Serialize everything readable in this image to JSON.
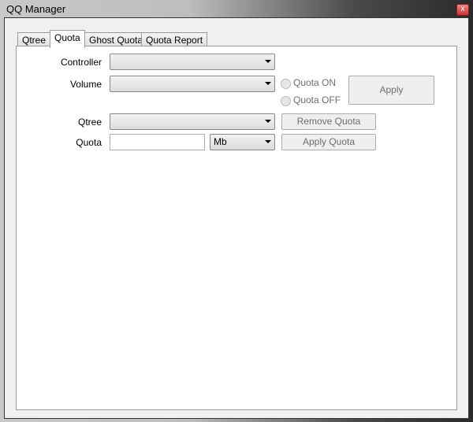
{
  "window": {
    "title": "QQ Manager",
    "close_label": "x"
  },
  "tabs": [
    {
      "label": "Qtree"
    },
    {
      "label": "Quota"
    },
    {
      "label": "Ghost Quota"
    },
    {
      "label": "Quota Report"
    }
  ],
  "form": {
    "controller_label": "Controller",
    "controller_value": "",
    "volume_label": "Volume",
    "volume_value": "",
    "quota_on_label": "Quota ON",
    "quota_off_label": "Quota OFF",
    "apply_label": "Apply",
    "qtree_label": "Qtree",
    "qtree_value": "",
    "remove_quota_label": "Remove Quota",
    "quota_label": "Quota",
    "quota_value": "",
    "unit_value": "Mb",
    "apply_quota_label": "Apply Quota"
  }
}
